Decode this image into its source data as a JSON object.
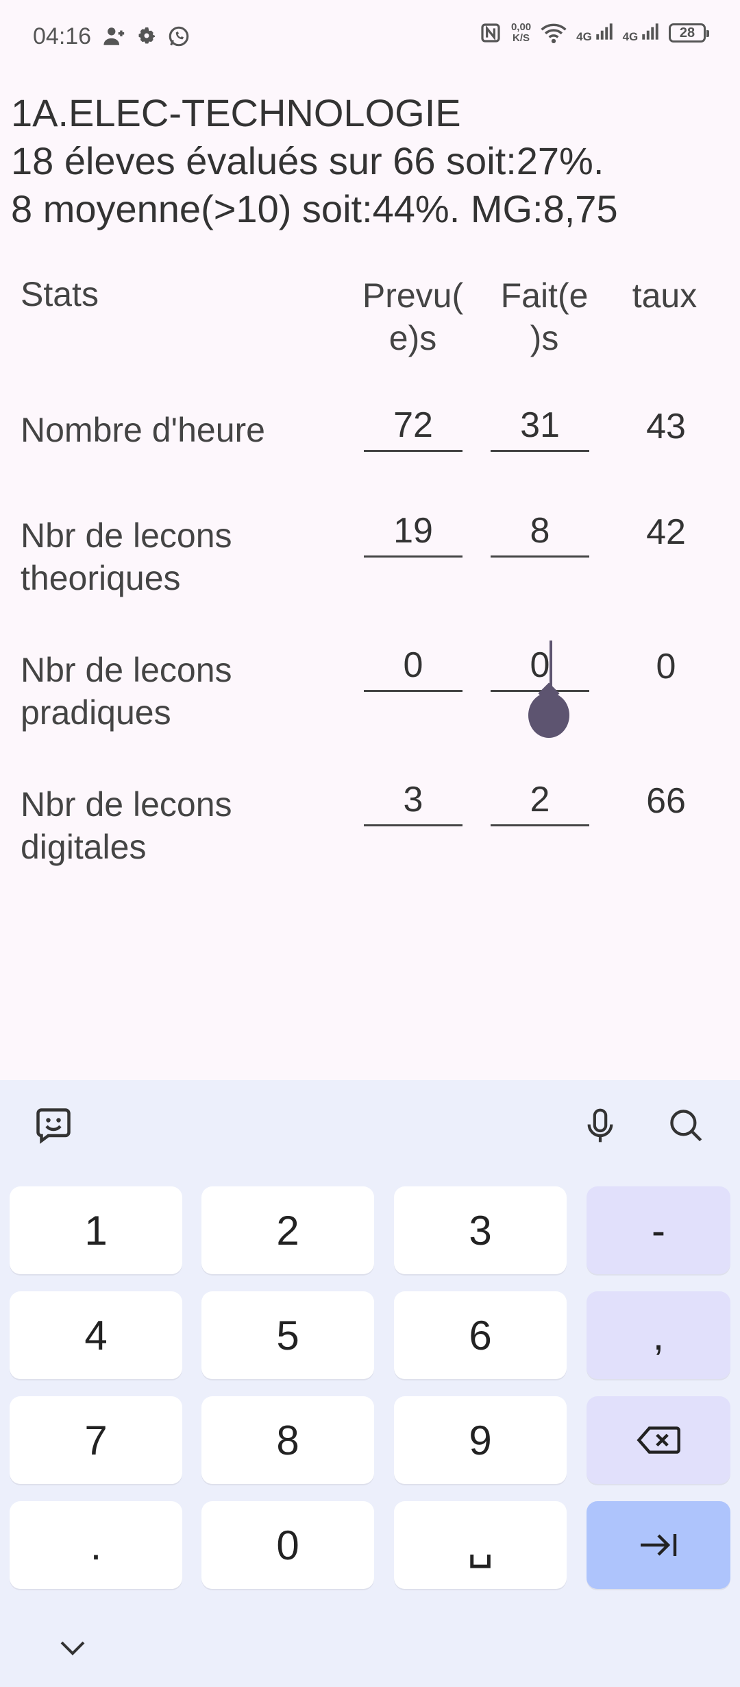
{
  "status_bar": {
    "time": "04:16",
    "left_icons": [
      "person-add-icon",
      "gear-icon",
      "whatsapp-icon"
    ],
    "net_speed_value": "0,00",
    "net_speed_unit": "K/S",
    "sim1": "4G",
    "sim2": "4G",
    "battery": "28"
  },
  "header": {
    "line1": "1A.ELEC-TECHNOLOGIE",
    "line2": "18 éleves évalués sur 66 soit:27%.",
    "line3": "8 moyenne(>10) soit:44%. MG:8,75"
  },
  "table": {
    "col_stats": "Stats",
    "col_prevu_1": "Prevu(",
    "col_prevu_2": "e)s",
    "col_fait_1": "Fait(e",
    "col_fait_2": ")s",
    "col_taux": "taux",
    "rows": [
      {
        "label_1": "Nombre d'heure",
        "label_2": "",
        "prevu": "72",
        "fait": "31",
        "taux": "43"
      },
      {
        "label_1": "Nbr de lecons",
        "label_2": "theoriques",
        "prevu": "19",
        "fait": "8",
        "taux": "42"
      },
      {
        "label_1": "Nbr de lecons",
        "label_2": "pradiques",
        "prevu": "0",
        "fait": "0",
        "taux": "0"
      },
      {
        "label_1": "Nbr de lecons",
        "label_2": "digitales",
        "prevu": "3",
        "fait": "2",
        "taux": "66"
      }
    ]
  },
  "keyboard": {
    "toolbar": [
      "emoji-sticker-icon",
      "microphone-icon",
      "search-icon"
    ],
    "keys": [
      [
        "1",
        "2",
        "3",
        "-"
      ],
      [
        "4",
        "5",
        "6",
        ","
      ],
      [
        "7",
        "8",
        "9",
        "backspace"
      ],
      [
        ".",
        "0",
        "␣",
        "tab"
      ]
    ],
    "accent": "#aec4fc"
  }
}
